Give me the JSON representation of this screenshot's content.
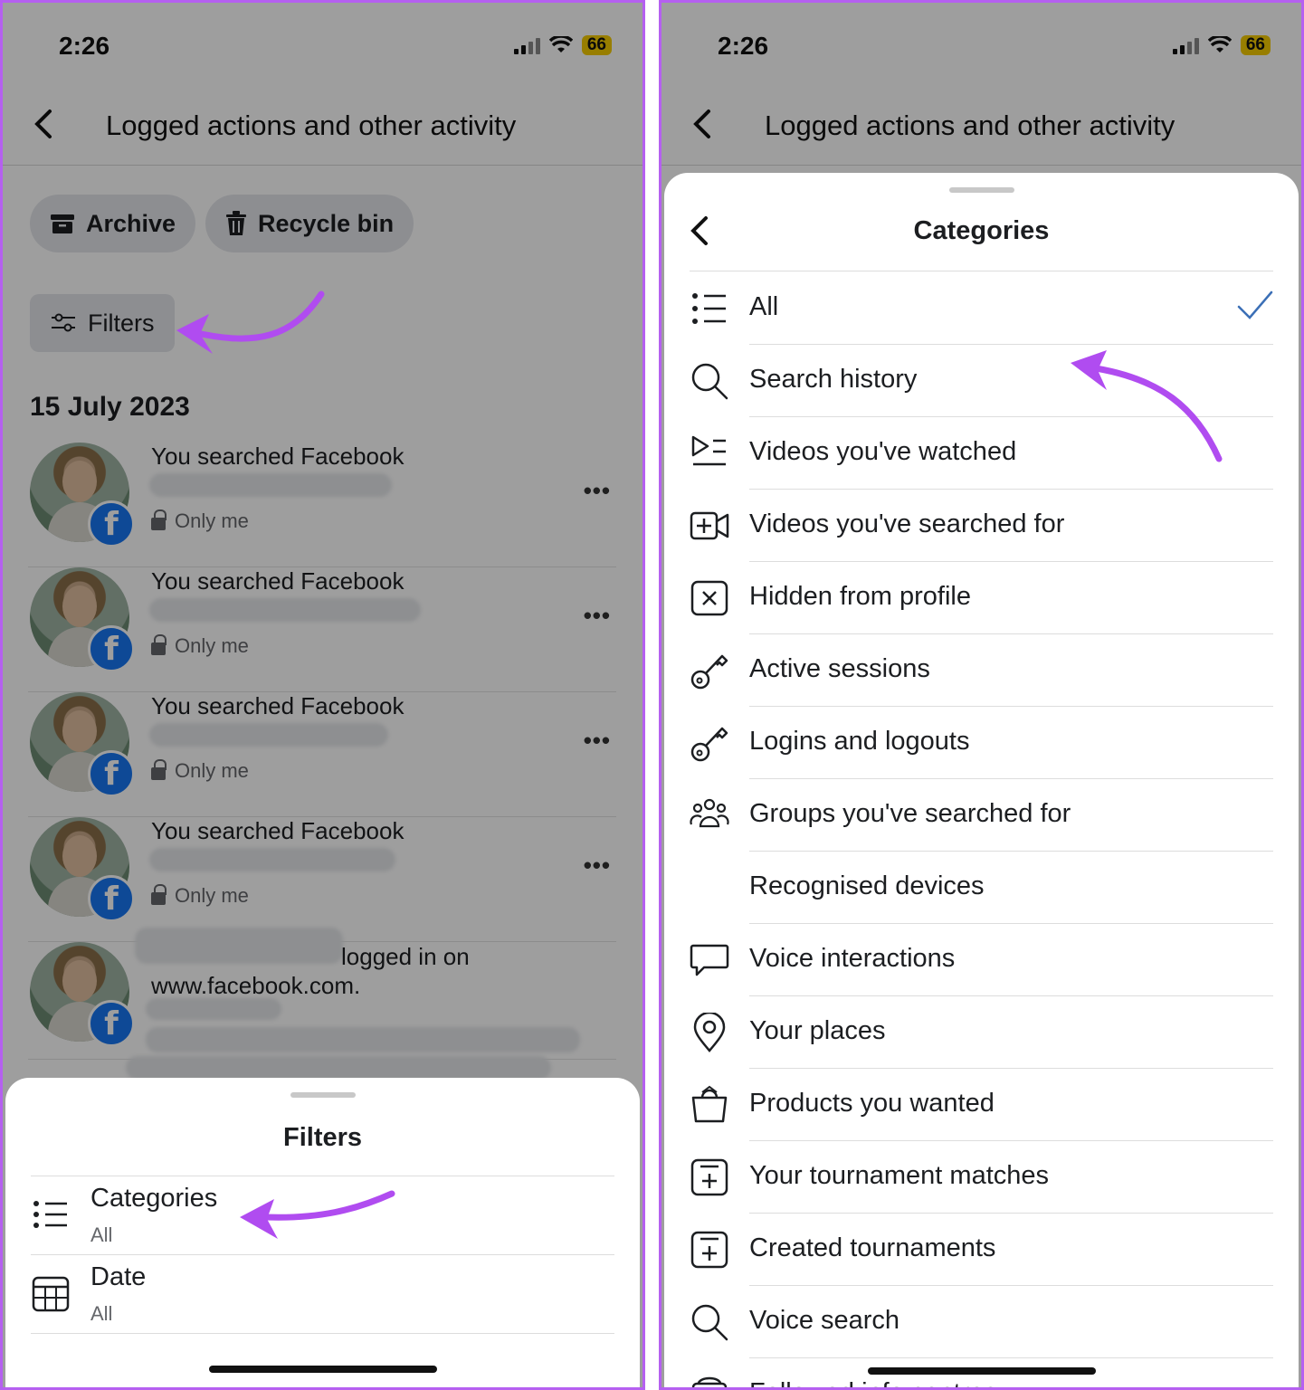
{
  "left_screen": {
    "status": {
      "time": "2:26",
      "battery": "66"
    },
    "header_title": "Logged actions and other activity",
    "archive_label": "Archive",
    "recycle_label": "Recycle bin",
    "filters_label": "Filters",
    "date_heading": "15 July 2023",
    "activities": [
      {
        "title": "You searched Facebook",
        "privacy": "Only me"
      },
      {
        "title": "You searched Facebook",
        "privacy": "Only me"
      },
      {
        "title": "You searched Facebook",
        "privacy": "Only me"
      },
      {
        "title": "You searched Facebook",
        "privacy": "Only me"
      }
    ],
    "activity_5": {
      "line1": "logged in on",
      "line2": "www.facebook.com."
    },
    "filters_sheet": {
      "title": "Filters",
      "rows": [
        {
          "label": "Categories",
          "value": "All"
        },
        {
          "label": "Date",
          "value": "All"
        }
      ]
    }
  },
  "right_screen": {
    "status": {
      "time": "2:26",
      "battery": "66"
    },
    "header_title": "Logged actions and other activity",
    "sheet_title": "Categories",
    "categories": [
      {
        "label": "All",
        "icon": "list-icon",
        "selected": true
      },
      {
        "label": "Search history",
        "icon": "search-icon"
      },
      {
        "label": "Videos you've watched",
        "icon": "video-list-icon"
      },
      {
        "label": "Videos you've searched for",
        "icon": "video-add-icon"
      },
      {
        "label": "Hidden from profile",
        "icon": "hidden-x-icon"
      },
      {
        "label": "Active sessions",
        "icon": "key-icon"
      },
      {
        "label": "Logins and logouts",
        "icon": "key-icon"
      },
      {
        "label": "Groups you've searched for",
        "icon": "groups-icon"
      },
      {
        "label": "Recognised devices",
        "icon": ""
      },
      {
        "label": "Voice interactions",
        "icon": "speech-bubble-icon"
      },
      {
        "label": "Your places",
        "icon": "location-pin-icon"
      },
      {
        "label": "Products you wanted",
        "icon": "shopping-bag-icon"
      },
      {
        "label": "Your tournament matches",
        "icon": "tournament-icon"
      },
      {
        "label": "Created tournaments",
        "icon": "tournament-icon"
      },
      {
        "label": "Voice search",
        "icon": "search-icon"
      },
      {
        "label": "Followed info centres",
        "icon": "info-centre-icon"
      }
    ]
  },
  "colors": {
    "annotation_arrow": "#b04cf0",
    "checkmark": "#3b6fb6",
    "facebook_blue": "#1877f2",
    "battery": "#f5cc00"
  }
}
